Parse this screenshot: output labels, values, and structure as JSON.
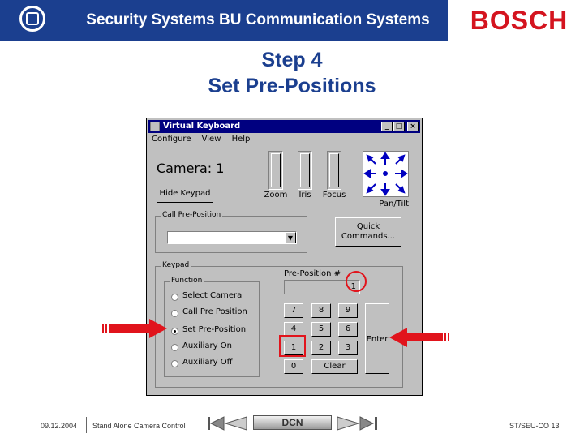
{
  "header": {
    "title": "Security Systems BU Communication Systems",
    "brand": "BOSCH"
  },
  "slide": {
    "line1": "Step 4",
    "line2": "Set Pre-Positions"
  },
  "window": {
    "title": "Virtual Keyboard",
    "menu": [
      "Configure",
      "View",
      "Help"
    ],
    "camera_label": "Camera: 1",
    "hide_keypad": "Hide Keypad",
    "lens": [
      "Zoom",
      "Iris",
      "Focus"
    ],
    "pantilt_label": "Pan/Tilt",
    "call_preposition_group": "Call Pre-Position",
    "quick_commands": "Quick\nCommands...",
    "keypad_group": "Keypad",
    "function_group": "Function",
    "functions": [
      "Select Camera",
      "Call Pre Position",
      "Set Pre-Position",
      "Auxiliary On",
      "Auxiliary Off"
    ],
    "selected_function": "Set Pre-Position",
    "preposition_label": "Pre-Position #",
    "preposition_value": "1",
    "keys": {
      "k7": "7",
      "k8": "8",
      "k9": "9",
      "k4": "4",
      "k5": "5",
      "k6": "6",
      "k1": "1",
      "k2": "2",
      "k3": "3",
      "k0": "0",
      "clear": "Clear",
      "enter": "Enter"
    }
  },
  "footer": {
    "date": "09.12.2004",
    "subject": "Stand Alone Camera Control",
    "nav_label": "DCN",
    "page": "ST/SEU-CO 13"
  },
  "colors": {
    "brand_blue": "#1b3f8f",
    "bosch_red": "#d4141f",
    "highlight_red": "#e1141c"
  }
}
